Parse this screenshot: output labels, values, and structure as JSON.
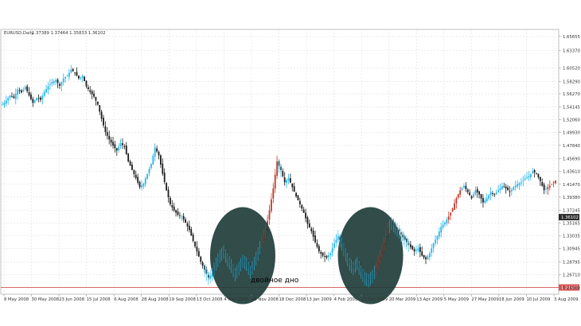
{
  "chart_data": {
    "type": "candlestick",
    "symbol_header": "EURUSD,Daily",
    "ohlc_header": "1.37389 1.37464 1.35833 1.36102",
    "price_axis_ticks": [
      "1.65655",
      "1.63370",
      "1.60520",
      "1.58290",
      "1.56270",
      "1.54145",
      "1.52060",
      "1.49930",
      "1.47840",
      "1.45690",
      "1.43610",
      "1.41470",
      "1.39380",
      "1.37245",
      "1.35165",
      "1.33035",
      "1.30945",
      "1.28795",
      "1.26710",
      "1.24560"
    ],
    "date_axis_ticks": [
      "8 May 2008",
      "30 May 2008",
      "23 Jun 2008",
      "15 Jul 2008",
      "6 Aug 2008",
      "28 Aug 2008",
      "19 Sep 2008",
      "13 Oct 2008",
      "4 Nov 2008",
      "26 Nov 2008",
      "18 Dec 2008",
      "13 Jan 2009",
      "4 Feb 2009",
      "26 Feb 2009",
      "20 Mar 2009",
      "13 Apr 2009",
      "5 May 2009",
      "27 May 2009",
      "18 Jun 2009",
      "10 Jul 2009",
      "3 Aug 2009"
    ],
    "current_price_label": "1.36102",
    "support_level_label": "1.24600",
    "support_level": 1.246,
    "ylim": [
      1.235,
      1.668
    ],
    "annotation": "двойное дно",
    "grid": true,
    "colors": {
      "up": "#29b6e8",
      "down": "#1c1c1c",
      "highlight_bull": "#c0392b",
      "circle": "#1f3d3a",
      "support": "#d9534f",
      "grid": "#d9d9d9",
      "axis_bg": "#ffffff"
    },
    "price_path": [
      [
        0,
        1.545
      ],
      [
        2,
        1.552
      ],
      [
        4,
        1.56
      ],
      [
        6,
        1.556
      ],
      [
        8,
        1.57
      ],
      [
        10,
        1.565
      ],
      [
        12,
        1.574
      ],
      [
        14,
        1.56
      ],
      [
        16,
        1.548
      ],
      [
        18,
        1.556
      ],
      [
        20,
        1.553
      ],
      [
        22,
        1.566
      ],
      [
        24,
        1.575
      ],
      [
        26,
        1.582
      ],
      [
        28,
        1.585
      ],
      [
        30,
        1.576
      ],
      [
        32,
        1.588
      ],
      [
        34,
        1.592
      ],
      [
        36,
        1.602
      ],
      [
        38,
        1.597
      ],
      [
        40,
        1.588
      ],
      [
        42,
        1.592
      ],
      [
        44,
        1.575
      ],
      [
        46,
        1.566
      ],
      [
        48,
        1.558
      ],
      [
        50,
        1.545
      ],
      [
        52,
        1.522
      ],
      [
        54,
        1.5
      ],
      [
        56,
        1.488
      ],
      [
        58,
        1.478
      ],
      [
        60,
        1.47
      ],
      [
        62,
        1.482
      ],
      [
        64,
        1.476
      ],
      [
        66,
        1.452
      ],
      [
        68,
        1.438
      ],
      [
        70,
        1.425
      ],
      [
        72,
        1.41
      ],
      [
        74,
        1.416
      ],
      [
        76,
        1.432
      ],
      [
        78,
        1.448
      ],
      [
        80,
        1.475
      ],
      [
        82,
        1.462
      ],
      [
        84,
        1.432
      ],
      [
        86,
        1.405
      ],
      [
        88,
        1.382
      ],
      [
        90,
        1.372
      ],
      [
        92,
        1.365
      ],
      [
        94,
        1.362
      ],
      [
        96,
        1.352
      ],
      [
        98,
        1.34
      ],
      [
        100,
        1.322
      ],
      [
        102,
        1.305
      ],
      [
        104,
        1.288
      ],
      [
        106,
        1.275
      ],
      [
        108,
        1.262
      ],
      [
        110,
        1.268
      ],
      [
        112,
        1.285
      ],
      [
        114,
        1.298
      ],
      [
        116,
        1.305
      ],
      [
        118,
        1.292
      ],
      [
        120,
        1.282
      ],
      [
        122,
        1.268
      ],
      [
        124,
        1.278
      ],
      [
        126,
        1.29
      ],
      [
        128,
        1.285
      ],
      [
        130,
        1.272
      ],
      [
        132,
        1.286
      ],
      [
        134,
        1.302
      ],
      [
        136,
        1.322
      ],
      [
        138,
        1.338
      ],
      [
        140,
        1.372
      ],
      [
        142,
        1.408
      ],
      [
        144,
        1.452
      ],
      [
        146,
        1.438
      ],
      [
        148,
        1.418
      ],
      [
        150,
        1.425
      ],
      [
        152,
        1.41
      ],
      [
        154,
        1.395
      ],
      [
        156,
        1.382
      ],
      [
        158,
        1.368
      ],
      [
        160,
        1.35
      ],
      [
        162,
        1.338
      ],
      [
        164,
        1.32
      ],
      [
        166,
        1.305
      ],
      [
        168,
        1.298
      ],
      [
        170,
        1.295
      ],
      [
        172,
        1.302
      ],
      [
        174,
        1.318
      ],
      [
        176,
        1.33
      ],
      [
        178,
        1.318
      ],
      [
        180,
        1.3
      ],
      [
        182,
        1.285
      ],
      [
        184,
        1.278
      ],
      [
        186,
        1.286
      ],
      [
        188,
        1.272
      ],
      [
        190,
        1.262
      ],
      [
        192,
        1.258
      ],
      [
        194,
        1.265
      ],
      [
        196,
        1.278
      ],
      [
        198,
        1.298
      ],
      [
        200,
        1.318
      ],
      [
        202,
        1.342
      ],
      [
        204,
        1.352
      ],
      [
        206,
        1.345
      ],
      [
        208,
        1.338
      ],
      [
        210,
        1.328
      ],
      [
        212,
        1.32
      ],
      [
        214,
        1.312
      ],
      [
        216,
        1.305
      ],
      [
        218,
        1.31
      ],
      [
        220,
        1.298
      ],
      [
        222,
        1.292
      ],
      [
        224,
        1.302
      ],
      [
        226,
        1.318
      ],
      [
        228,
        1.33
      ],
      [
        230,
        1.345
      ],
      [
        232,
        1.352
      ],
      [
        234,
        1.362
      ],
      [
        236,
        1.375
      ],
      [
        238,
        1.392
      ],
      [
        240,
        1.405
      ],
      [
        242,
        1.412
      ],
      [
        244,
        1.402
      ],
      [
        246,
        1.392
      ],
      [
        248,
        1.405
      ],
      [
        250,
        1.398
      ],
      [
        252,
        1.385
      ],
      [
        254,
        1.392
      ],
      [
        256,
        1.402
      ],
      [
        258,
        1.398
      ],
      [
        260,
        1.405
      ],
      [
        262,
        1.412
      ],
      [
        264,
        1.408
      ],
      [
        266,
        1.402
      ],
      [
        268,
        1.41
      ],
      [
        270,
        1.415
      ],
      [
        272,
        1.418
      ],
      [
        274,
        1.424
      ],
      [
        276,
        1.428
      ],
      [
        278,
        1.436
      ],
      [
        280,
        1.432
      ],
      [
        282,
        1.42
      ],
      [
        284,
        1.405
      ],
      [
        286,
        1.41
      ],
      [
        288,
        1.415
      ],
      [
        290,
        1.421
      ]
    ],
    "bull_highlight_index_ranges": [
      [
        136,
        144
      ],
      [
        196,
        202
      ],
      [
        234,
        240
      ],
      [
        286,
        290
      ]
    ],
    "double_bottom_circles": [
      {
        "center_date": "11 Nov 2008",
        "center_price": 1.298
      },
      {
        "center_date": "14 Feb 2009",
        "center_price": 1.298
      }
    ]
  }
}
